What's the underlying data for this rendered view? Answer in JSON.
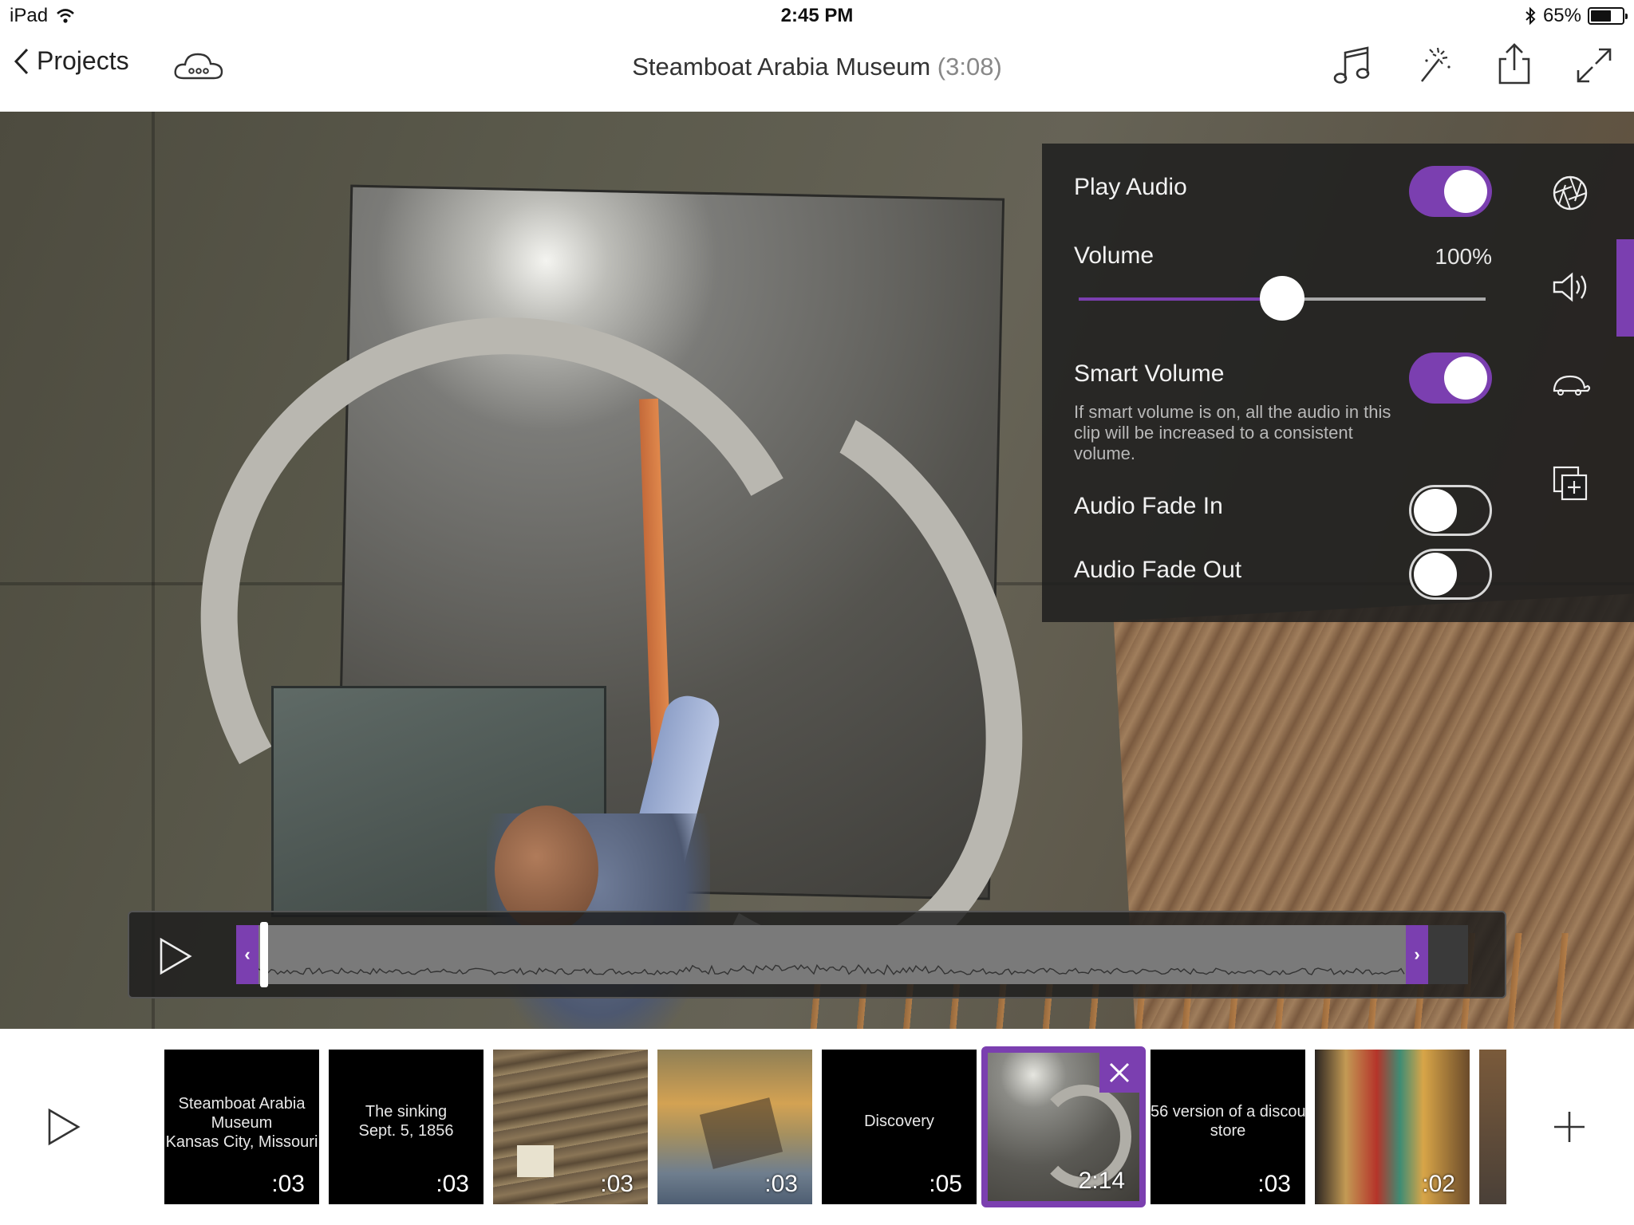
{
  "status_bar": {
    "device": "iPad",
    "time": "2:45 PM",
    "battery_text": "65%",
    "battery_level": 0.65
  },
  "nav": {
    "back_label": "Projects",
    "title": "Steamboat Arabia Museum",
    "duration": "(3:08)"
  },
  "audio_panel": {
    "play_audio": {
      "label": "Play Audio",
      "on": true
    },
    "volume": {
      "label": "Volume",
      "value_text": "100%",
      "level": 0.5
    },
    "smart_volume": {
      "label": "Smart Volume",
      "on": true,
      "description": "If smart volume is on, all the audio in this clip will be increased to a consistent volume."
    },
    "fade_in": {
      "label": "Audio Fade In",
      "on": false
    },
    "fade_out": {
      "label": "Audio Fade Out",
      "on": false
    }
  },
  "trim": {
    "left_handle": "‹",
    "right_handle": "›"
  },
  "filmstrip": {
    "clips": [
      {
        "type": "title",
        "text": [
          "Steamboat Arabia",
          "Museum",
          "Kansas City, Missouri"
        ],
        "duration": ":03"
      },
      {
        "type": "title",
        "text": [
          "The sinking",
          "Sept. 5, 1856"
        ],
        "duration": ":03"
      },
      {
        "type": "photo",
        "duration": ":03"
      },
      {
        "type": "photo",
        "duration": ":03"
      },
      {
        "type": "title",
        "text": [
          "Discovery"
        ],
        "duration": ":05"
      },
      {
        "type": "video",
        "duration": "2:14",
        "selected": true
      },
      {
        "type": "title",
        "text": [
          "56 version of a discou",
          "store"
        ],
        "duration": ":03"
      },
      {
        "type": "photo",
        "duration": ":02"
      }
    ]
  },
  "colors": {
    "accent": "#7b3fb0"
  }
}
